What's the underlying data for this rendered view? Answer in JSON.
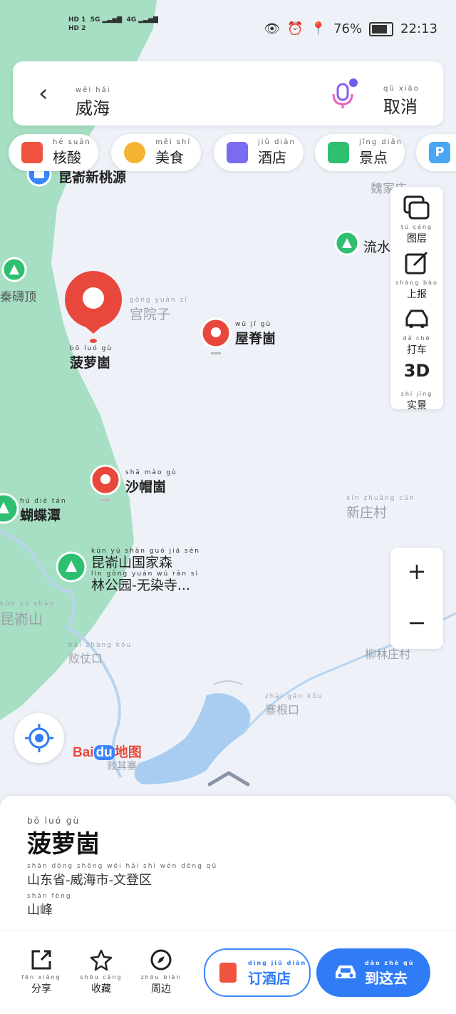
{
  "status_bar": {
    "sim1": "HD 1",
    "sim2": "HD 2",
    "net1": "5G",
    "net2": "4G",
    "battery": "76%",
    "time": "22:13"
  },
  "search": {
    "query": "威海",
    "query_pinyin": "wēi hǎi",
    "cancel_label": "取消",
    "cancel_pinyin": "qǔ xiāo"
  },
  "chips": [
    {
      "label": "核酸",
      "pinyin": "hé suān",
      "icon": "test-tube-icon",
      "color": "#f0533e"
    },
    {
      "label": "美食",
      "pinyin": "měi shí",
      "icon": "food-icon",
      "color": "#f5b431"
    },
    {
      "label": "酒店",
      "pinyin": "jiǔ diàn",
      "icon": "hotel-icon",
      "color": "#7a6cf0"
    },
    {
      "label": "景点",
      "pinyin": "jǐng diǎn",
      "icon": "scenic-icon",
      "color": "#2fbf71"
    }
  ],
  "side_tools": [
    {
      "label": "图层",
      "pinyin": "tú céng",
      "icon": "layers-icon"
    },
    {
      "label": "上报",
      "pinyin": "shàng bào",
      "icon": "report-icon"
    },
    {
      "label": "打车",
      "pinyin": "dǎ chē",
      "icon": "taxi-icon"
    },
    {
      "label": "实景",
      "pinyin": "shí jǐng",
      "icon": "3d-icon",
      "glyph": "3D"
    }
  ],
  "zoom": {
    "in": "+",
    "out": "−"
  },
  "map_labels": {
    "kunyu_xintaoyuan": "昆嵛新桃源",
    "weijia": "魏家庄",
    "liushui": "流水",
    "qinbei_ding": "秦礴顶",
    "gongyuanzi": "宫院子",
    "gongyuanzi_py": "gōng yuàn zǐ",
    "boluo_ding": "菠萝崮",
    "boluo_py": "bō luó gù",
    "wuji_gu": "屋脊崮",
    "wuji_py": "wū jǐ gù",
    "shamao_gu": "沙帽崮",
    "shamao_py": "shā mào gù",
    "xinzhuang": "新庄村",
    "xinzhuang_py": "xīn zhuāng cūn",
    "hudie_tan": "蝴蝶潭",
    "hudie_py": "hú dié tán",
    "kunyu_park_1": "昆嵛山国家森",
    "kunyu_park_1_py": "kūn yú shān guó jiā sēn",
    "kunyu_park_2": "林公园-无染寺...",
    "kunyu_park_2_py": "lín gōng yuán  wú rǎn sì",
    "kunyu_shan": "昆嵛山",
    "kunyu_shan_py": "kūn yú shān",
    "baizhangkou": "败仗口",
    "baizhangkou_py": "bài zhàng kǒu",
    "liulinzhuang": "柳林庄村",
    "zhaigenkou": "寨根口",
    "zhaigenkou_py": "zhài gēn kǒu",
    "baiqiqi": "败其寨"
  },
  "baidu_logo": {
    "text1": "Bai",
    "text2": "du",
    "text3": "地图"
  },
  "place": {
    "name": "菠萝崮",
    "name_pinyin": "bō luó gù",
    "address": "山东省-威海市-文登区",
    "address_pinyin": "shān dōng shěng  wēi hǎi shì  wén dēng qū",
    "type": "山峰",
    "type_pinyin": "shān fēng"
  },
  "actions": {
    "share": "分享",
    "share_py": "fēn xiǎng",
    "favorite": "收藏",
    "favorite_py": "shōu cáng",
    "nearby": "周边",
    "nearby_py": "zhōu biān",
    "book_hotel": "订酒店",
    "book_hotel_py": "dìng jiǔ diàn",
    "go_here": "到这去",
    "go_here_py": "dào zhè qù"
  },
  "colors": {
    "accent": "#2f7cf6",
    "pin": "#e8483c",
    "land": "#a6dfc3",
    "water": "#a9cdf0",
    "map_bg": "#eef2f8"
  }
}
